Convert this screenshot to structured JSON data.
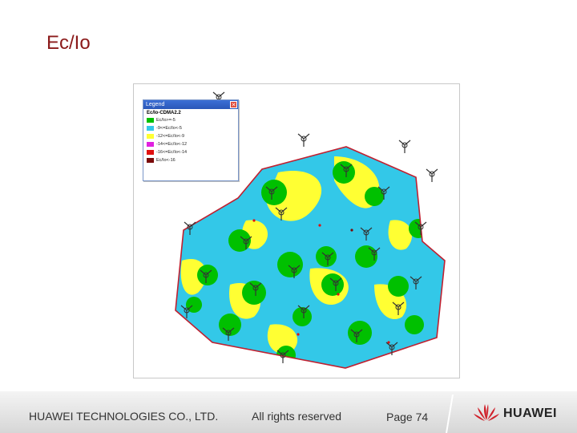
{
  "slide": {
    "title": "Ec/Io"
  },
  "legend": {
    "window_title": "Legend",
    "close_label": "✕",
    "heading": "Ec/Io-CDMA2.2",
    "items": [
      {
        "label": "Ec/Io>=-5",
        "color": "#00c000"
      },
      {
        "label": "-9<=Ec/Io<-5",
        "color": "#33c8e8"
      },
      {
        "label": "-12<=Ec/Io<-9",
        "color": "#ffff33"
      },
      {
        "label": "-14<=Ec/Io<-12",
        "color": "#e020e0"
      },
      {
        "label": "-16<=Ec/Io<-14",
        "color": "#e01010"
      },
      {
        "label": "Ec/Io<-16",
        "color": "#7a0a0a"
      }
    ]
  },
  "footer": {
    "company": "HUAWEI TECHNOLOGIES CO., LTD.",
    "rights": "All rights reserved",
    "page": "Page 74",
    "brand": "HUAWEI"
  },
  "colors": {
    "title": "#8b1a1a",
    "boundary": "#c02030",
    "site": "#333333",
    "brand_red": "#d0202a"
  }
}
